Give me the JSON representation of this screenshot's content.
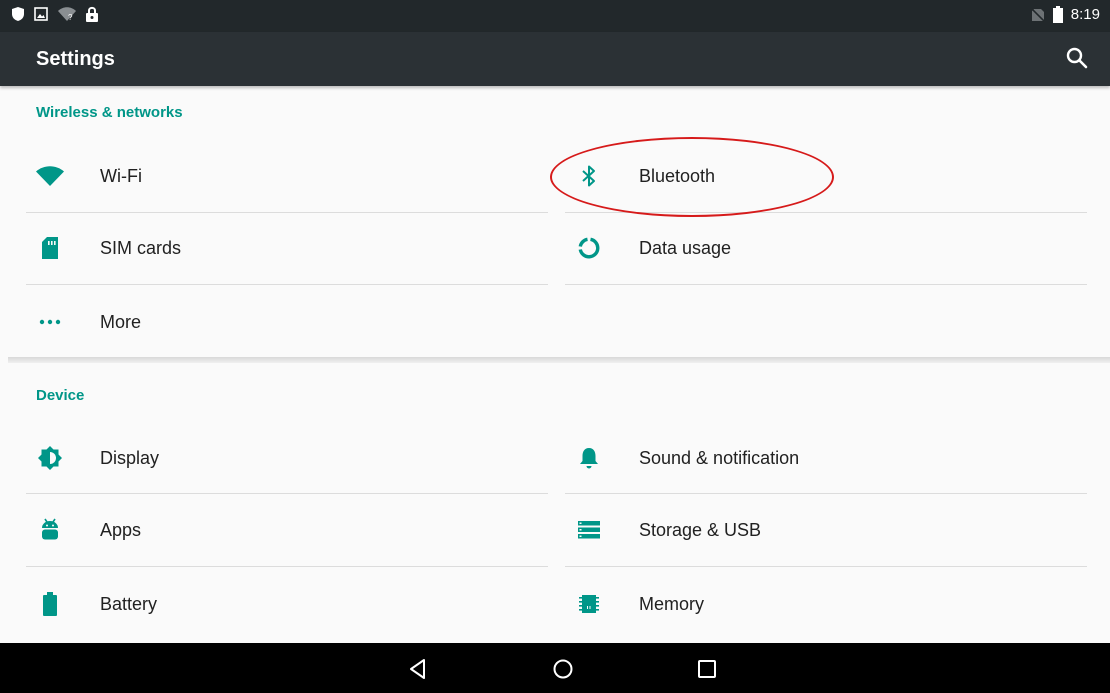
{
  "status_bar": {
    "time": "8:19",
    "left_icons": [
      "shield-icon",
      "image-icon",
      "wifi-unknown-icon",
      "lock-icon"
    ],
    "right_icons": [
      "no-sim-icon",
      "battery-icon"
    ]
  },
  "app_bar": {
    "title": "Settings",
    "search_icon": "search-icon"
  },
  "sections": {
    "wireless": {
      "title": "Wireless & networks",
      "wifi": "Wi-Fi",
      "bluetooth": "Bluetooth",
      "sim_cards": "SIM cards",
      "data_usage": "Data usage",
      "more": "More"
    },
    "device": {
      "title": "Device",
      "display": "Display",
      "sound": "Sound & notification",
      "apps": "Apps",
      "storage": "Storage & USB",
      "battery": "Battery",
      "memory": "Memory"
    }
  },
  "nav_bar": {
    "back": "back-icon",
    "home": "home-icon",
    "recents": "recents-icon"
  },
  "colors": {
    "accent": "#009688",
    "status_bar": "#22282b",
    "app_bar": "#2b3135",
    "annotation": "#d61a1a"
  }
}
